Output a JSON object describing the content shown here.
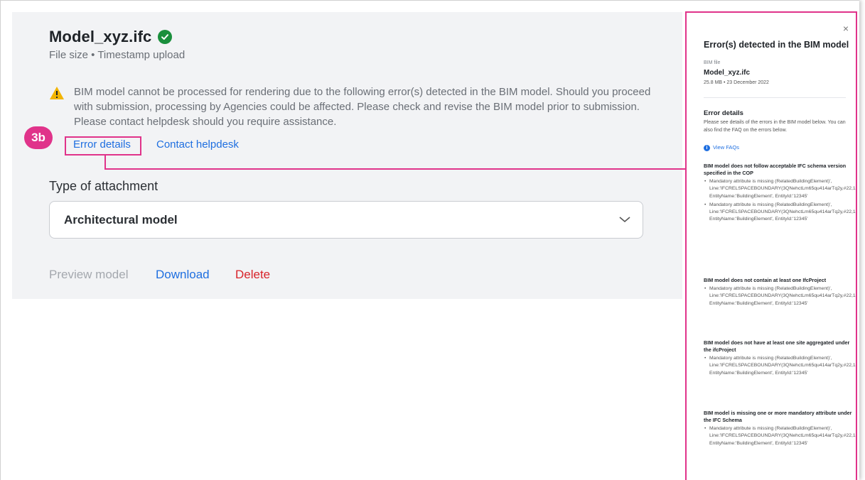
{
  "file": {
    "name": "Model_xyz.ifc",
    "meta": "File size • Timestamp upload"
  },
  "warning": {
    "text": "BIM model cannot be processed for rendering due to the following error(s) detected in the BIM model. Should you proceed with submission, processing by Agencies could be affected. Please check and revise the BIM model prior to submission. Please contact helpdesk should you require assistance."
  },
  "links": {
    "error_details": "Error details",
    "contact_helpdesk": "Contact helpdesk"
  },
  "annotation": {
    "step": "3b",
    "color": "#e0338a"
  },
  "attachment": {
    "label": "Type of attachment",
    "selected": "Architectural model"
  },
  "actions": {
    "preview": "Preview model",
    "download": "Download",
    "delete": "Delete"
  },
  "drawer": {
    "close": "×",
    "title": "Error(s) detected in the BIM model",
    "file_label": "BIM file",
    "file_name": "Model_xyz.ifc",
    "file_meta": "25.8 MB • 23 December 2022",
    "section_title": "Error details",
    "section_desc": "Please see details of the errors in the BIM model below. You can also find the FAQ on the errors below.",
    "faq_link": "View FAQs",
    "errors": [
      {
        "heading": "BIM model does not follow acceptable IFC schema version specified in the COP",
        "items": [
          "Mandatory attribute is missing (RelatedBuildingElement)', Line:'IFCRELSPACEBOUNDARY(3QNehctLm65qu414arTq2y,#22,1stLevel), EntityName:'BuildingElement', EntityId:'12345'",
          "Mandatory attribute is missing (RelatedBuildingElement)', Line:'IFCRELSPACEBOUNDARY(3QNehctLm65qu414arTq2y,#22,1stLevel), EntityName:'BuildingElement', EntityId:'12345'"
        ]
      },
      {
        "heading": "BIM model does not contain at least one IfcProject",
        "items": [
          "Mandatory attribute is missing (RelatedBuildingElement)', Line:'IFCRELSPACEBOUNDARY(3QNehctLm65qu414arTq2y,#22,1stLevel), EntityName:'BuildingElement', EntityId:'12345'"
        ]
      },
      {
        "heading": "BIM model does not have at least one site aggregated under the ifcProject",
        "items": [
          "Mandatory attribute is missing (RelatedBuildingElement)', Line:'IFCRELSPACEBOUNDARY(3QNehctLm65qu414arTq2y,#22,1stLevel), EntityName:'BuildingElement', EntityId:'12345'"
        ]
      },
      {
        "heading": "BIM model is missing one or more mandatory attribute under the IFC Schema",
        "items": [
          "Mandatory attribute is missing (RelatedBuildingElement)', Line:'IFCRELSPACEBOUNDARY(3QNehctLm65qu414arTq2y,#22,1stLevel), EntityName:'BuildingElement', EntityId:'12345'"
        ]
      }
    ]
  }
}
